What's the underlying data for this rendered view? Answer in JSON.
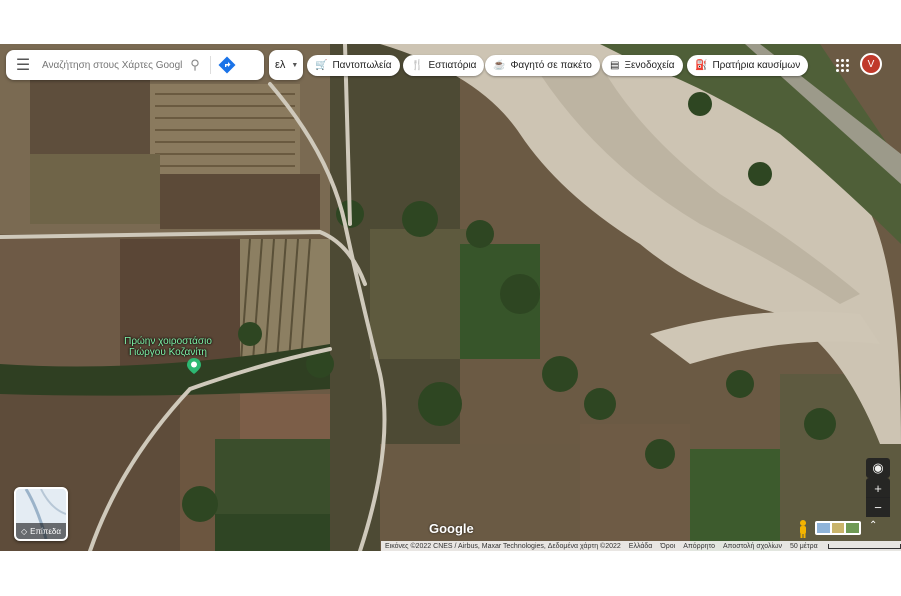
{
  "search": {
    "placeholder": "Αναζήτηση στους Χάρτες Google"
  },
  "language": {
    "label": "ελ"
  },
  "chips": [
    {
      "label": "Παντοπωλεία",
      "icon": "cart-icon"
    },
    {
      "label": "Εστιατόρια",
      "icon": "utensils-icon"
    },
    {
      "label": "Φαγητό σε πακέτο",
      "icon": "takeout-icon"
    },
    {
      "label": "Ξενοδοχεία",
      "icon": "bed-icon"
    },
    {
      "label": "Πρατήρια καυσίμων",
      "icon": "fuel-icon"
    }
  ],
  "account": {
    "initial": "V",
    "color": "#c0392b"
  },
  "poi": {
    "name": "Πρώην χοιροστάσιο Γιώργου Κοζανίτη",
    "label_color": "#7ef2a8"
  },
  "layers": {
    "label": "Επίπεδα"
  },
  "controls": {
    "zoom_in": "+",
    "zoom_out": "−",
    "collapse": "⌃"
  },
  "brand": {
    "logo_text": "Google"
  },
  "footer": {
    "imagery": "Εικόνες ©2022 CNES / Airbus, Maxar Technologies, Δεδομένα χάρτη ©2022",
    "country": "Ελλάδα",
    "terms": "Όροι",
    "privacy": "Απόρρητο",
    "feedback": "Αποστολή σχολίων",
    "scale": "50 μέτρα"
  },
  "map_colors": {
    "field_brown": "#6b5a44",
    "vegetation": "#3f5a2e",
    "riverbed": "#cfc6b6"
  }
}
